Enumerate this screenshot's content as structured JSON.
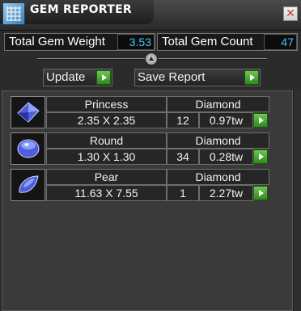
{
  "window": {
    "title": "GEM REPORTER",
    "close_glyph": "✕",
    "icon": "app-grid-icon"
  },
  "stats": {
    "weight_label": "Total Gem Weight",
    "weight_value": "3.53",
    "count_label": "Total Gem Count",
    "count_value": "47"
  },
  "actions": {
    "update_label": "Update",
    "save_label": "Save Report"
  },
  "colors": {
    "value_text": "#49c2f0",
    "play_button": "#3fa42a"
  },
  "gems": [
    {
      "icon": "princess-gem-icon",
      "cut": "Princess",
      "material": "Diamond",
      "size": "2.35 X 2.35",
      "count": "12",
      "weight": "0.97tw"
    },
    {
      "icon": "round-gem-icon",
      "cut": "Round",
      "material": "Diamond",
      "size": "1.30 X 1.30",
      "count": "34",
      "weight": "0.28tw"
    },
    {
      "icon": "pear-gem-icon",
      "cut": "Pear",
      "material": "Diamond",
      "size": "11.63 X 7.55",
      "count": "1",
      "weight": "2.27tw"
    }
  ]
}
